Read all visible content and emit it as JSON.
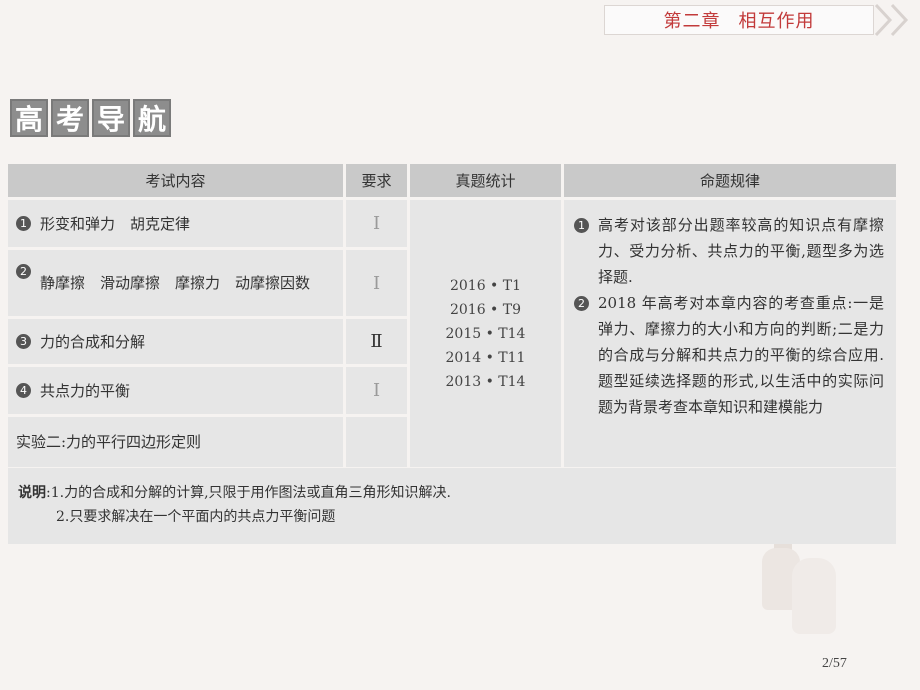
{
  "banner": {
    "chapter": "第二章",
    "title": "相互作用"
  },
  "heading": [
    "高",
    "考",
    "导",
    "航"
  ],
  "table": {
    "headers": [
      "考试内容",
      "要求",
      "真题统计",
      "命题规律"
    ],
    "rows": [
      {
        "num": "1",
        "content": "形变和弹力　胡克定律",
        "requirement": "Ⅰ"
      },
      {
        "num": "2",
        "content": "静摩擦　滑动摩擦　摩擦力　动摩擦因数",
        "requirement": "Ⅰ"
      },
      {
        "num": "3",
        "content": "力的合成和分解",
        "requirement": "Ⅱ"
      },
      {
        "num": "4",
        "content": "共点力的平衡",
        "requirement": "Ⅰ"
      },
      {
        "num": "",
        "content": "实验二:力的平行四边形定则",
        "requirement": ""
      }
    ],
    "stats": [
      "2016 • T1",
      "2016 • T9",
      "2015 • T14",
      "2014 • T11",
      "2013 • T14"
    ],
    "rules": [
      {
        "num": "1",
        "text": "高考对该部分出题率较高的知识点有摩擦力、受力分析、共点力的平衡,题型多为选择题."
      },
      {
        "num": "2",
        "text": "2018 年高考对本章内容的考查重点:一是弹力、摩擦力的大小和方向的判断;二是力的合成与分解和共点力的平衡的综合应用.题型延续选择题的形式,以生活中的实际问题为背景考查本章知识和建模能力"
      }
    ]
  },
  "note": {
    "label": "说明",
    "line1": ":1.力的合成和分解的计算,只限于用作图法或直角三角形知识解决.",
    "line2": "2.只要求解决在一个平面内的共点力平衡问题"
  },
  "pager": "2/57"
}
